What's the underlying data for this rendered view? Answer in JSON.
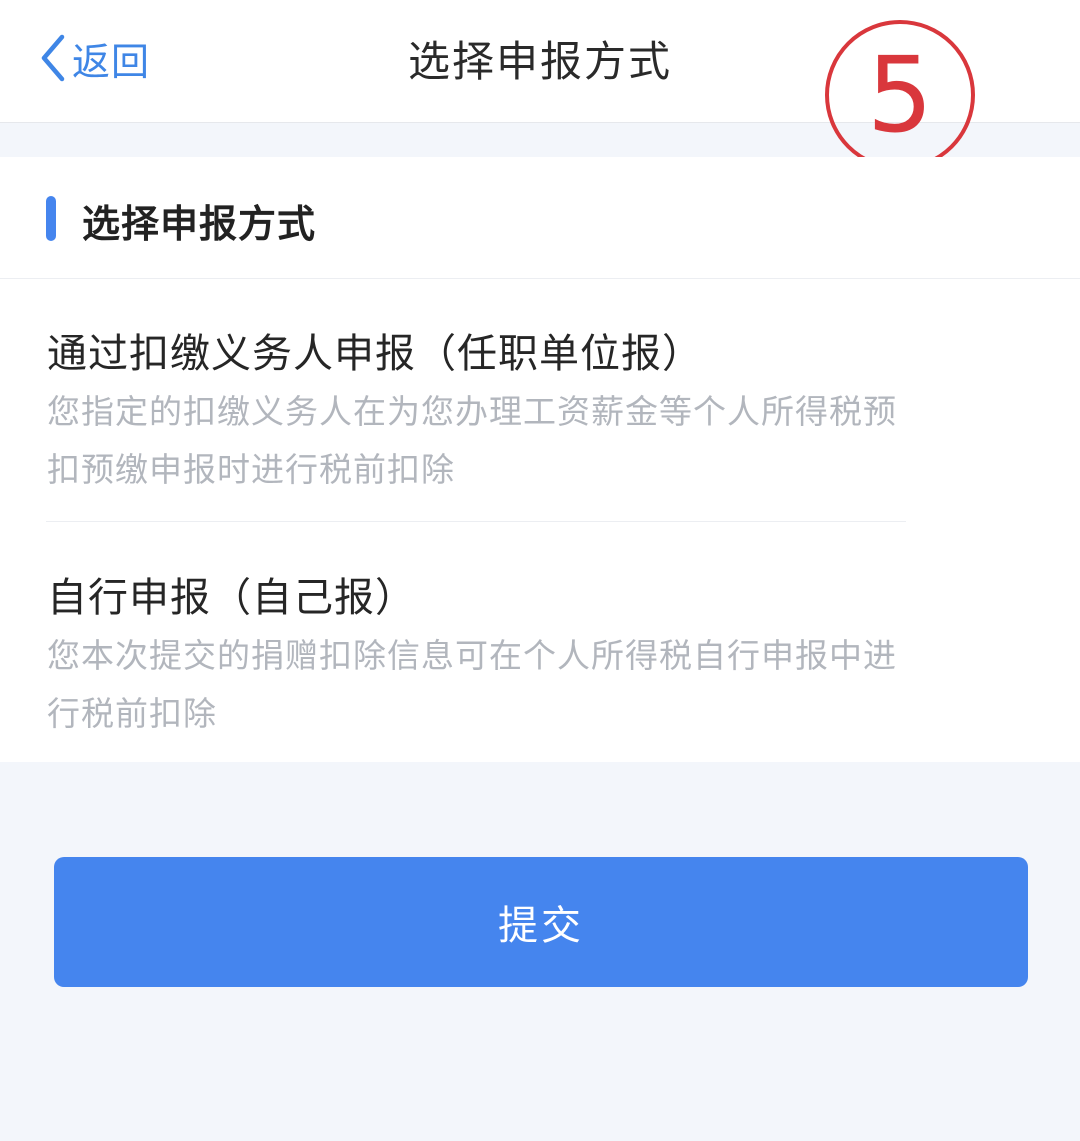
{
  "nav": {
    "back_label": "返回",
    "title": "选择申报方式"
  },
  "step_mark": "5",
  "section": {
    "title": "选择申报方式"
  },
  "options": [
    {
      "title": "通过扣缴义务人申报（任职单位报）",
      "description": "您指定的扣缴义务人在为您办理工资薪金等个人所得税预扣预缴申报时进行税前扣除"
    },
    {
      "title": "自行申报（自己报）",
      "description": "您本次提交的捐赠扣除信息可在个人所得税自行申报中进行税前扣除"
    }
  ],
  "submit_label": "提交",
  "colors": {
    "accent": "#4585ee",
    "step_mark": "#d9373c",
    "background": "#f3f6fb"
  },
  "icons": {
    "back": "chevron-left-icon"
  }
}
